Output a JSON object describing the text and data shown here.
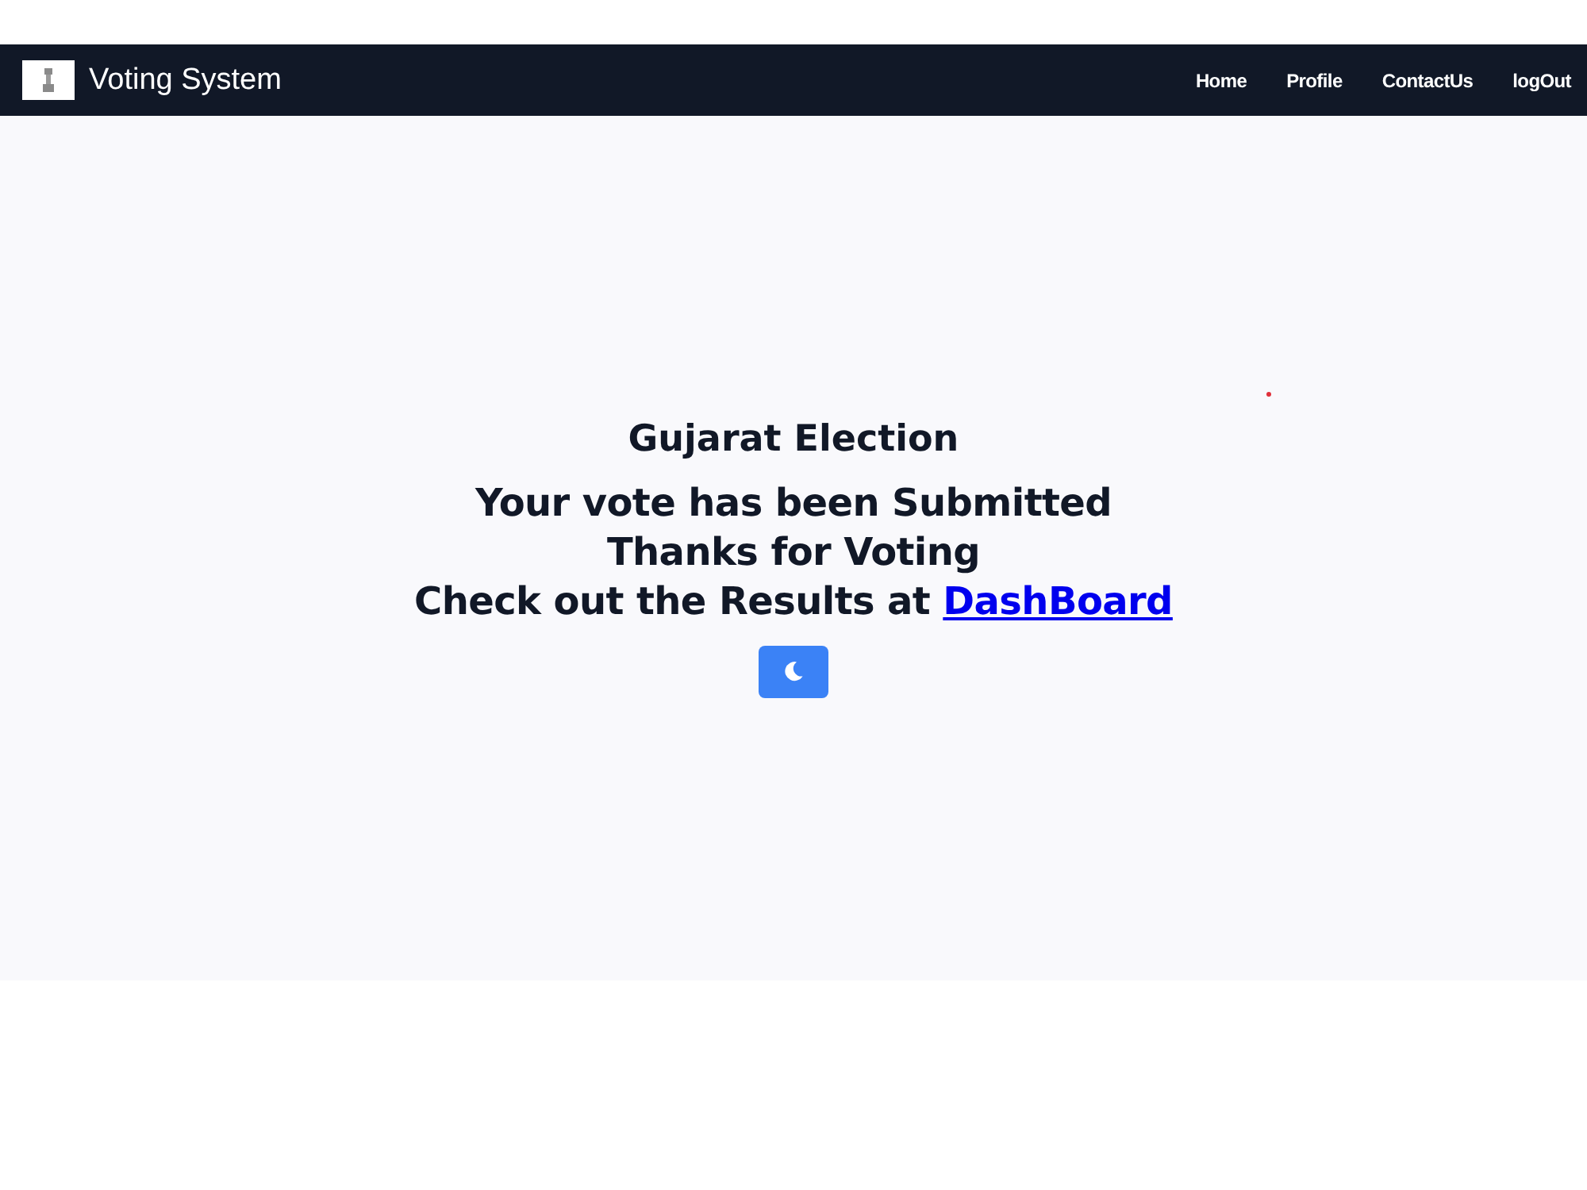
{
  "navbar": {
    "brand": "Voting System",
    "links": [
      {
        "label": "Home"
      },
      {
        "label": "Profile"
      },
      {
        "label": "ContactUs"
      },
      {
        "label": "logOut"
      }
    ]
  },
  "message": {
    "heading": "Gujarat Election",
    "lines": [
      "Your vote has been Submitted",
      "Thanks for Voting"
    ],
    "results_text": "Check out the Results at",
    "results_link": "DashBoard"
  }
}
